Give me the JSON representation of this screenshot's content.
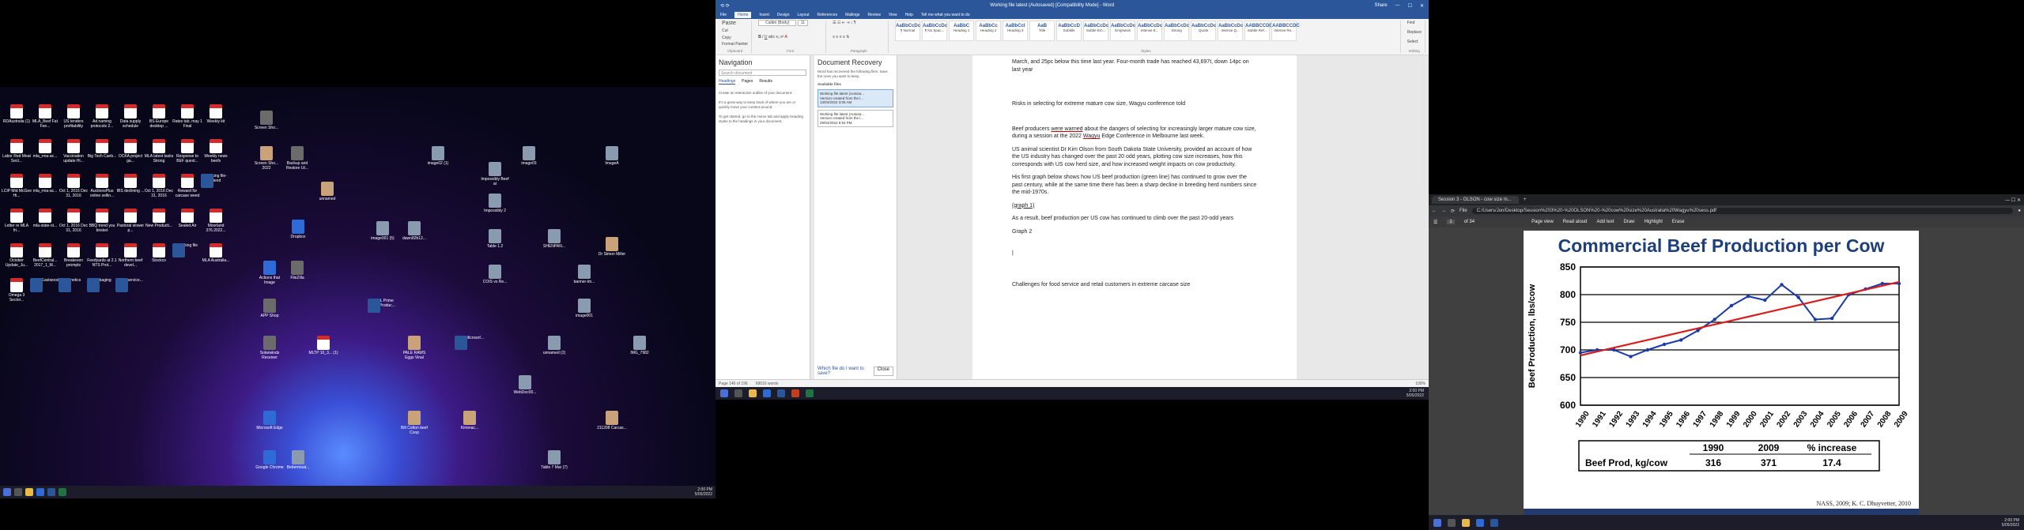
{
  "desktop": {
    "clock": {
      "time": "2:00 PM",
      "date": "5/05/2022"
    },
    "icons": [
      {
        "label": "RDAustralia (1)",
        "type": "pdf"
      },
      {
        "label": "MLA_Beef Fat Fee...",
        "type": "pdf"
      },
      {
        "label": "US tenders profitability",
        "type": "pdf"
      },
      {
        "label": "Ad naming protocols 2...",
        "type": "pdf"
      },
      {
        "label": "Data supply schedule",
        "type": "pdf"
      },
      {
        "label": "BS Europe desktop ...",
        "type": "pdf"
      },
      {
        "label": "Rates tab, may 1 Final",
        "type": "pdf"
      },
      {
        "label": "Weekly kit",
        "type": "pdf"
      },
      {
        "label": "Labor Red Meat Sect...",
        "type": "pdf"
      },
      {
        "label": "mla_rma-ac...",
        "type": "pdf"
      },
      {
        "label": "Vaccination update Hi...",
        "type": "pdf"
      },
      {
        "label": "Big Tech Canb...",
        "type": "pdf"
      },
      {
        "label": "OCKA project ga...",
        "type": "pdf"
      },
      {
        "label": "MLA latest tasks Strong",
        "type": "pdf"
      },
      {
        "label": "Response to BEF quest...",
        "type": "pdf"
      },
      {
        "label": "Weekly news beefs",
        "type": "pdf"
      },
      {
        "label": "LCIP Mid McGee Hi...",
        "type": "pdf"
      },
      {
        "label": "mla_rma-ac...",
        "type": "pdf"
      },
      {
        "label": "Oct 1, 2016 Dec 31, 2016",
        "type": "pdf"
      },
      {
        "label": "AuctionsPlus online sellin...",
        "type": "pdf"
      },
      {
        "label": "IBS declining ...",
        "type": "pdf"
      },
      {
        "label": "Oct 1, 2016 Dec 31, 2016",
        "type": "pdf"
      },
      {
        "label": "Reward for carcase weed",
        "type": "pdf"
      },
      {
        "label": "Working file-friend",
        "type": "word"
      },
      {
        "label": "Letter re MLA fri...",
        "type": "pdf"
      },
      {
        "label": "mla-state-st...",
        "type": "pdf"
      },
      {
        "label": "Oct 1, 2016 Dec 31, 2016",
        "type": "pdf"
      },
      {
        "label": "BBQ trend you brisket",
        "type": "pdf"
      },
      {
        "label": "Pastoral slower p...",
        "type": "pdf"
      },
      {
        "label": "New Producti...",
        "type": "pdf"
      },
      {
        "label": "Sealed Air",
        "type": "pdf"
      },
      {
        "label": "Moorland 376.2022...",
        "type": "pdf"
      },
      {
        "label": "October Update_Ju...",
        "type": "pdf"
      },
      {
        "label": "BeefCentral... 2017_1_M...",
        "type": "pdf"
      },
      {
        "label": "Breakeven prompts",
        "type": "pdf"
      },
      {
        "label": "Feedyards at 2.1 NTS Prot...",
        "type": "pdf"
      },
      {
        "label": "Northern beef devel...",
        "type": "pdf"
      },
      {
        "label": "Stockco",
        "type": "pdf"
      },
      {
        "label": "Working file",
        "type": "word"
      },
      {
        "label": "MLA Australia...",
        "type": "pdf"
      },
      {
        "label": "Omega 3 Sector...",
        "type": "pdf"
      },
      {
        "label": "Brent Eastwood",
        "type": "word"
      },
      {
        "label": "genetics",
        "type": "word"
      },
      {
        "label": "Packaging",
        "type": "word"
      },
      {
        "label": "Stud service...",
        "type": "word"
      }
    ],
    "right_icons": [
      {
        "label": "Screen Sho...",
        "type": "app"
      },
      {
        "label": "Screen Sho... 2022",
        "type": "photo"
      },
      {
        "label": "Backup and Restore Ut...",
        "type": "app"
      },
      {
        "label": "unnamed",
        "type": "photo"
      },
      {
        "label": "image02 (1)",
        "type": "img"
      },
      {
        "label": "Impossibly Beef at",
        "type": "img"
      },
      {
        "label": "image03",
        "type": "img"
      },
      {
        "label": "ImageA",
        "type": "img"
      },
      {
        "label": "Impossibly 2",
        "type": "img"
      },
      {
        "label": "Dropbox",
        "type": "blue"
      },
      {
        "label": "image001 (5)",
        "type": "img"
      },
      {
        "label": "dawn82b12...",
        "type": "img"
      },
      {
        "label": "Table 1.2",
        "type": "img"
      },
      {
        "label": "SHENPAN...",
        "type": "img"
      },
      {
        "label": "Dr Simon Miller",
        "type": "photo"
      },
      {
        "label": "Actions that Image",
        "type": "blue"
      },
      {
        "label": "FileZilla",
        "type": "app"
      },
      {
        "label": "COIS vs Re...",
        "type": "img"
      },
      {
        "label": "banner-im...",
        "type": "img"
      },
      {
        "label": "APP Shop",
        "type": "app"
      },
      {
        "label": "NBCL Prime Beef Produc...",
        "type": "word"
      },
      {
        "label": "image001",
        "type": "img"
      },
      {
        "label": "Solarwinds Receiver",
        "type": "app"
      },
      {
        "label": "MLTP 10_3... (1)",
        "type": "pdf"
      },
      {
        "label": "PALE RAWS Eggs Vinal",
        "type": "photo"
      },
      {
        "label": "Wool Microsof...",
        "type": "word"
      },
      {
        "label": "unnamed (2)",
        "type": "img"
      },
      {
        "label": "IMG_7982",
        "type": "img"
      },
      {
        "label": "WebDoc00...",
        "type": "img"
      },
      {
        "label": "Microsoft Edge",
        "type": "blue"
      },
      {
        "label": "Bill Cotton beef Coop",
        "type": "photo"
      },
      {
        "label": "Kimmac...",
        "type": "photo"
      },
      {
        "label": "211208 Carcas...",
        "type": "photo"
      },
      {
        "label": "Google Chrome",
        "type": "blue"
      },
      {
        "label": "Bettermeat...",
        "type": "img"
      },
      {
        "label": "Table 7 Mar (7)",
        "type": "img"
      }
    ]
  },
  "word": {
    "title": "Working file latest (Autosaved) [Compatibility Mode] - Word",
    "search": "Search",
    "user": "Share",
    "tabs": [
      "File",
      "Home",
      "Insert",
      "Design",
      "Layout",
      "References",
      "Mailings",
      "Review",
      "View",
      "Help",
      "Tell me what you want to do"
    ],
    "groups": {
      "clipboard": "Clipboard",
      "font": "Font",
      "paragraph": "Paragraph",
      "styles": "Styles",
      "editing": "Editing",
      "paste": "Paste",
      "cut": "Cut",
      "copy": "Copy",
      "format_painter": "Format Painter",
      "font_name": "Calibri (Body)",
      "font_size": "11",
      "find": "Find",
      "replace": "Replace",
      "select": "Select"
    },
    "style_gallery": [
      {
        "sample": "AaBbCcDc",
        "name": "¶ Normal"
      },
      {
        "sample": "AaBbCcDc",
        "name": "¶ No Spac..."
      },
      {
        "sample": "AaBbC",
        "name": "Heading 1"
      },
      {
        "sample": "AaBbCc",
        "name": "Heading 2"
      },
      {
        "sample": "AaBbCcI",
        "name": "Heading 3"
      },
      {
        "sample": "AaB",
        "name": "Title"
      },
      {
        "sample": "AaBbCcD",
        "name": "Subtitle"
      },
      {
        "sample": "AaBbCcDc",
        "name": "Subtle Em..."
      },
      {
        "sample": "AaBbCcDc",
        "name": "Emphasis"
      },
      {
        "sample": "AaBbCcDc",
        "name": "Intense E..."
      },
      {
        "sample": "AaBbCcDc",
        "name": "Strong"
      },
      {
        "sample": "AaBbCcDc",
        "name": "Quote"
      },
      {
        "sample": "AaBbCcDc",
        "name": "Intense Q..."
      },
      {
        "sample": "AABBCCDC",
        "name": "Subtle Ref..."
      },
      {
        "sample": "AABBCCDC",
        "name": "Intense Re..."
      }
    ],
    "navigation": {
      "title": "Navigation",
      "search_placeholder": "Search document",
      "tabs": [
        "Headings",
        "Pages",
        "Results"
      ],
      "hint1": "Create an interactive outline of your document.",
      "hint2": "It's a great way to keep track of where you are or quickly move your content around.",
      "hint3": "To get started, go to the Home tab and apply Heading styles to the headings in your document."
    },
    "recovery": {
      "title": "Document Recovery",
      "desc": "Word has recovered the following files. Save the ones you want to keep.",
      "available": "Available files",
      "files": [
        {
          "name": "Working file latest (Autosa...",
          "note": "Version created from the l...",
          "time": "13/04/2022 3:06 AM"
        },
        {
          "name": "Working file latest (Autosa...",
          "note": "Version created from the l...",
          "time": "29/04/2022 6:54 PM"
        }
      ],
      "which": "Which file do I want to save?",
      "close": "Close"
    },
    "doc": {
      "p0": "March, and 25pc below this time last year. Four-month trade has reached 43,697t, down 14pc on last year",
      "heading": "Risks in selecting for extreme mature cow size, Wagyu conference told",
      "p1a": "Beef producers ",
      "p1warned": "were warned",
      "p1b": " about the dangers of selecting for increasingly larger mature cow size, during a session at the 2022 ",
      "p1wagyu": "Wagyu",
      "p1c": " Edge Conference in Melbourne last week.",
      "p2": "US animal scientist Dr Kim Olson from South Dakota State University, provided an account of how the US industry has changed over the past 20 odd years, plotting cow size increases, how this corresponds with US cow herd size, and how increased weight impacts on cow productivity.",
      "p3": "His first graph below shows how US beef production (green line) has continued to grow over the past century, while at the same time there has been a sharp decline in breeding herd numbers since the mid-1970s.",
      "graph1": "(graph 1)",
      "p4": "As a result, beef production per US cow has continued to climb over the past 20-odd years",
      "graph2": "Graph 2",
      "p5": "Challenges for food service and retail customers in extreme carcase size"
    },
    "status": {
      "page": "Page 146 of 196",
      "words": "69016 words",
      "zoom": "100%"
    }
  },
  "browser": {
    "tab_title": "Session 3 - OLSON - cow size m...",
    "url": "C:/Users/Jon/Desktop/Session%203%20-%20OLSON%20-%20cow%20size%20Australia%20Wagyu%20sess.pdf",
    "file_label": "File",
    "page_num": "1",
    "page_total": "of 34",
    "tools": [
      "Page view",
      "Read aloud",
      "Add text",
      "Draw",
      "Highlight",
      "Erase"
    ]
  },
  "chart_data": {
    "type": "line",
    "title": "Commercial Beef Production per Cow",
    "xlabel": "",
    "ylabel": "Beef Production, lbs/cow",
    "ylim": [
      600,
      850
    ],
    "yticks": [
      600,
      650,
      700,
      750,
      800,
      850
    ],
    "x": [
      1990,
      1991,
      1992,
      1993,
      1994,
      1995,
      1996,
      1997,
      1998,
      1999,
      2000,
      2001,
      2002,
      2003,
      2004,
      2005,
      2006,
      2007,
      2008,
      2009
    ],
    "series": [
      {
        "name": "",
        "values": [
          695,
          700,
          700,
          688,
          700,
          710,
          718,
          735,
          755,
          780,
          797,
          790,
          818,
          795,
          755,
          757,
          800,
          810,
          820,
          820
        ],
        "color": "#1a3aa8"
      },
      {
        "name": "",
        "values": [
          690,
          697,
          704,
          711,
          718,
          725,
          732,
          739,
          746,
          753,
          760,
          767,
          774,
          781,
          788,
          795,
          802,
          809,
          816,
          823
        ],
        "color": "#d81f1f"
      }
    ],
    "table": {
      "headers": [
        "",
        "1990",
        "2009",
        "% increase"
      ],
      "rows": [
        [
          "Beef Prod, kg/cow",
          "316",
          "371",
          "17.4"
        ]
      ]
    },
    "source": "NASS, 2009; K. C. Dhuyvetter, 2010",
    "grid": true
  }
}
